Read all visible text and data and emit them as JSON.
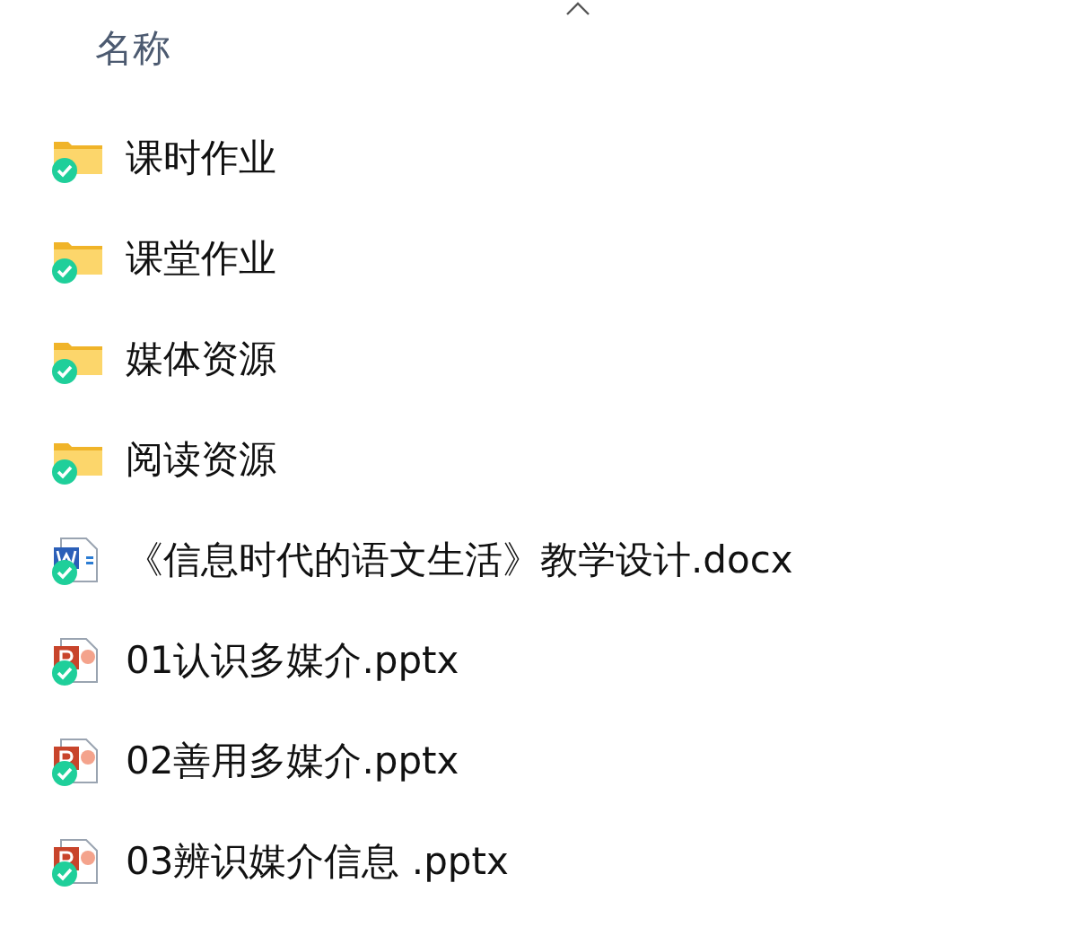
{
  "column_header": {
    "label": "名称",
    "sorted": true
  },
  "files": [
    {
      "name": "课时作业",
      "kind": "folder",
      "synced": true
    },
    {
      "name": "课堂作业",
      "kind": "folder",
      "synced": true
    },
    {
      "name": "媒体资源",
      "kind": "folder",
      "synced": true
    },
    {
      "name": "阅读资源",
      "kind": "folder",
      "synced": true
    },
    {
      "name": "《信息时代的语文生活》教学设计.docx",
      "kind": "word",
      "synced": true
    },
    {
      "name": "01认识多媒介.pptx",
      "kind": "ppt",
      "synced": true
    },
    {
      "name": "02善用多媒介.pptx",
      "kind": "ppt",
      "synced": true
    },
    {
      "name": "03辨识媒介信息 .pptx",
      "kind": "ppt",
      "synced": true
    }
  ]
}
